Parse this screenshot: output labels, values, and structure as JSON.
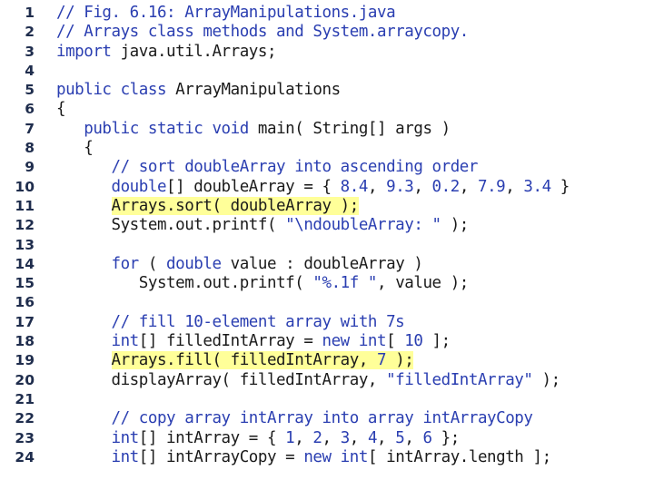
{
  "colors": {
    "comment": "#2a3eb1",
    "keyword": "#2a3eb1",
    "string": "#2a3eb1",
    "number": "#2a3eb1",
    "plain": "#1a1a1a",
    "line_number": "#1f2d4d",
    "highlight": "#ffff99"
  },
  "lines": [
    {
      "num": "1",
      "indent": "",
      "highlight": false,
      "tokens": [
        [
          "c",
          "// Fig. 6.16: ArrayManipulations.java"
        ]
      ]
    },
    {
      "num": "2",
      "indent": "",
      "highlight": false,
      "tokens": [
        [
          "c",
          "// Arrays class methods and System.arraycopy."
        ]
      ]
    },
    {
      "num": "3",
      "indent": "",
      "highlight": false,
      "tokens": [
        [
          "k",
          "import"
        ],
        [
          "p",
          " java.util.Arrays;"
        ]
      ]
    },
    {
      "num": "4",
      "indent": "",
      "highlight": false,
      "tokens": []
    },
    {
      "num": "5",
      "indent": "",
      "highlight": false,
      "tokens": [
        [
          "k",
          "public class"
        ],
        [
          "p",
          " ArrayManipulations"
        ]
      ]
    },
    {
      "num": "6",
      "indent": "",
      "highlight": false,
      "tokens": [
        [
          "p",
          "{"
        ]
      ]
    },
    {
      "num": "7",
      "indent": "   ",
      "highlight": false,
      "tokens": [
        [
          "k",
          "public static void"
        ],
        [
          "p",
          " main( String[] args )"
        ]
      ]
    },
    {
      "num": "8",
      "indent": "   ",
      "highlight": false,
      "tokens": [
        [
          "p",
          "{"
        ]
      ]
    },
    {
      "num": "9",
      "indent": "      ",
      "highlight": false,
      "tokens": [
        [
          "c",
          "// sort doubleArray into ascending order"
        ]
      ]
    },
    {
      "num": "10",
      "indent": "      ",
      "highlight": false,
      "tokens": [
        [
          "k",
          "double"
        ],
        [
          "p",
          "[] doubleArray = { "
        ],
        [
          "n",
          "8.4"
        ],
        [
          "p",
          ", "
        ],
        [
          "n",
          "9.3"
        ],
        [
          "p",
          ", "
        ],
        [
          "n",
          "0.2"
        ],
        [
          "p",
          ", "
        ],
        [
          "n",
          "7.9"
        ],
        [
          "p",
          ", "
        ],
        [
          "n",
          "3.4"
        ],
        [
          "p",
          " }"
        ]
      ]
    },
    {
      "num": "11",
      "indent": "      ",
      "highlight": true,
      "tokens": [
        [
          "p",
          "Arrays.sort( doubleArray );"
        ]
      ]
    },
    {
      "num": "12",
      "indent": "      ",
      "highlight": false,
      "tokens": [
        [
          "p",
          "System.out.printf( "
        ],
        [
          "s",
          "\"\\ndoubleArray: \""
        ],
        [
          "p",
          " );"
        ]
      ]
    },
    {
      "num": "13",
      "indent": "",
      "highlight": false,
      "tokens": []
    },
    {
      "num": "14",
      "indent": "      ",
      "highlight": false,
      "tokens": [
        [
          "k",
          "for"
        ],
        [
          "p",
          " ( "
        ],
        [
          "k",
          "double"
        ],
        [
          "p",
          " value : doubleArray )"
        ]
      ]
    },
    {
      "num": "15",
      "indent": "         ",
      "highlight": false,
      "tokens": [
        [
          "p",
          "System.out.printf( "
        ],
        [
          "s",
          "\"%.1f \""
        ],
        [
          "p",
          ", value );"
        ]
      ]
    },
    {
      "num": "16",
      "indent": "",
      "highlight": false,
      "tokens": []
    },
    {
      "num": "17",
      "indent": "      ",
      "highlight": false,
      "tokens": [
        [
          "c",
          "// fill 10-element array with 7s"
        ]
      ]
    },
    {
      "num": "18",
      "indent": "      ",
      "highlight": false,
      "tokens": [
        [
          "k",
          "int"
        ],
        [
          "p",
          "[] filledIntArray = "
        ],
        [
          "k",
          "new int"
        ],
        [
          "p",
          "[ "
        ],
        [
          "n",
          "10"
        ],
        [
          "p",
          " ];"
        ]
      ]
    },
    {
      "num": "19",
      "indent": "      ",
      "highlight": true,
      "tokens": [
        [
          "p",
          "Arrays.fill( filledIntArray, "
        ],
        [
          "n",
          "7"
        ],
        [
          "p",
          " );"
        ]
      ]
    },
    {
      "num": "20",
      "indent": "      ",
      "highlight": false,
      "tokens": [
        [
          "p",
          "displayArray( filledIntArray, "
        ],
        [
          "s",
          "\"filledIntArray\""
        ],
        [
          "p",
          " );"
        ]
      ]
    },
    {
      "num": "21",
      "indent": "",
      "highlight": false,
      "tokens": []
    },
    {
      "num": "22",
      "indent": "      ",
      "highlight": false,
      "tokens": [
        [
          "c",
          "// copy array intArray into array intArrayCopy"
        ]
      ]
    },
    {
      "num": "23",
      "indent": "      ",
      "highlight": false,
      "tokens": [
        [
          "k",
          "int"
        ],
        [
          "p",
          "[] intArray = { "
        ],
        [
          "n",
          "1"
        ],
        [
          "p",
          ", "
        ],
        [
          "n",
          "2"
        ],
        [
          "p",
          ", "
        ],
        [
          "n",
          "3"
        ],
        [
          "p",
          ", "
        ],
        [
          "n",
          "4"
        ],
        [
          "p",
          ", "
        ],
        [
          "n",
          "5"
        ],
        [
          "p",
          ", "
        ],
        [
          "n",
          "6"
        ],
        [
          "p",
          " };"
        ]
      ]
    },
    {
      "num": "24",
      "indent": "      ",
      "highlight": false,
      "tokens": [
        [
          "k",
          "int"
        ],
        [
          "p",
          "[] intArrayCopy = "
        ],
        [
          "k",
          "new int"
        ],
        [
          "p",
          "[ intArray.length ];"
        ]
      ]
    }
  ]
}
